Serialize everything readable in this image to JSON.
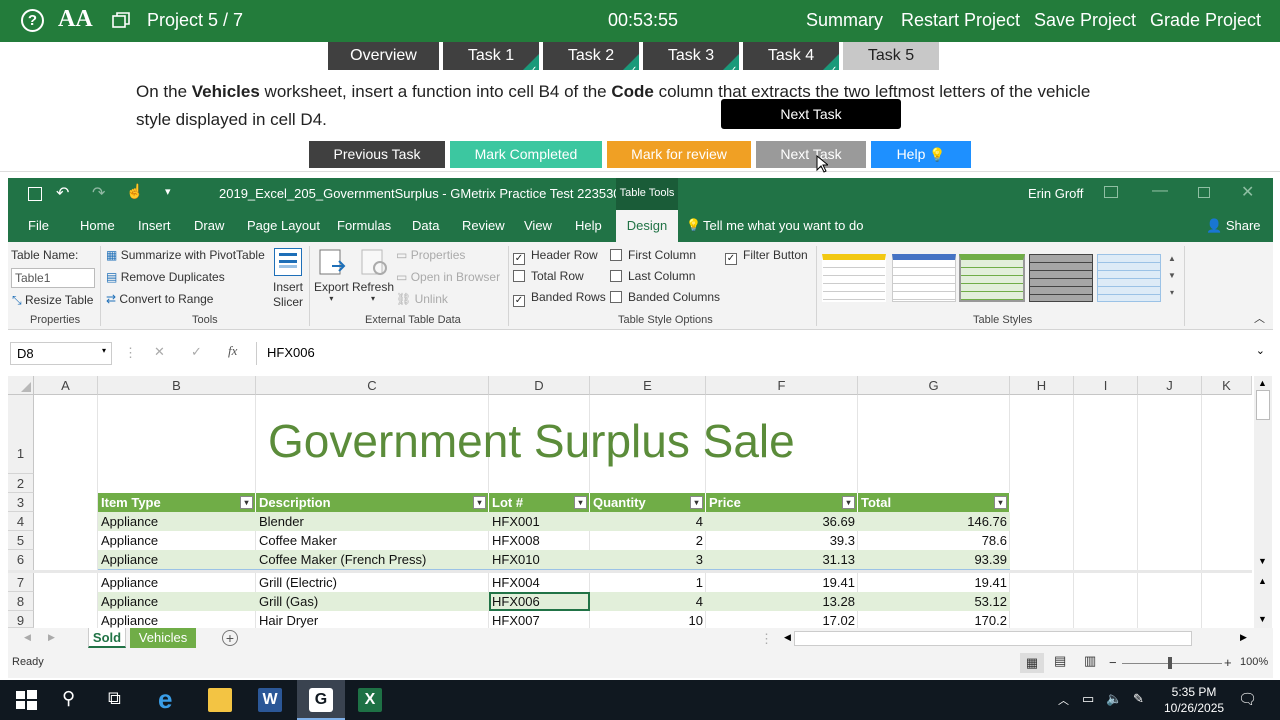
{
  "topbar": {
    "project": "Project 5 / 7",
    "timer": "00:53:55",
    "links": [
      "Summary",
      "Restart Project",
      "Save Project",
      "Grade Project"
    ],
    "font_icon": "AA"
  },
  "tasks": [
    {
      "label": "Overview",
      "done": false
    },
    {
      "label": "Task 1",
      "done": true
    },
    {
      "label": "Task 2",
      "done": true
    },
    {
      "label": "Task 3",
      "done": true
    },
    {
      "label": "Task 4",
      "done": true
    },
    {
      "label": "Task 5",
      "done": false,
      "active": true
    }
  ],
  "instruction": {
    "p1": "On the ",
    "b1": "Vehicles",
    "p2": " worksheet, insert a function into cell B4 of the ",
    "b2": "Code",
    "p3": " column that extracts the two leftmost letters of the vehicle style displayed in cell D4."
  },
  "tooltip": "Next Task",
  "actions": {
    "previous": "Previous Task",
    "mark_completed": "Mark Completed",
    "mark_review": "Mark for review",
    "next": "Next Task",
    "help": "Help"
  },
  "colors": {
    "brand": "#237c3b",
    "excel": "#217346",
    "table_header": "#70ad47",
    "title_green": "#5b8c3a",
    "review": "#f0a024",
    "completed": "#3cc7a0",
    "help": "#1e90ff"
  },
  "excel": {
    "filename": "2019_Excel_205_GovernmentSurplus  -  GMetrix Practice Test 223530",
    "context_tab": "Table Tools",
    "user": "Erin Groff",
    "menu": [
      "File",
      "Home",
      "Insert",
      "Draw",
      "Page Layout",
      "Formulas",
      "Data",
      "Review",
      "View",
      "Help",
      "Design"
    ],
    "tell_me": "Tell me what you want to do",
    "share": "Share",
    "ribbon": {
      "table_name_label": "Table Name:",
      "table_name_value": "Table1",
      "resize": "Resize Table",
      "properties": "Properties",
      "summarize": "Summarize with PivotTable",
      "remove_dup": "Remove Duplicates",
      "convert": "Convert to Range",
      "tools": "Tools",
      "insert_slicer_1": "Insert",
      "insert_slicer_2": "Slicer",
      "export": "Export",
      "refresh": "Refresh",
      "ext_properties": "Properties",
      "open_browser": "Open in Browser",
      "unlink": "Unlink",
      "external": "External Table Data",
      "header_row": "Header Row",
      "total_row": "Total Row",
      "banded_rows": "Banded Rows",
      "first_column": "First Column",
      "last_column": "Last Column",
      "banded_columns": "Banded Columns",
      "filter_button": "Filter Button",
      "style_options": "Table Style Options",
      "table_styles": "Table Styles"
    },
    "name_box": "D8",
    "formula": "HFX006",
    "columns": [
      "A",
      "B",
      "C",
      "D",
      "E",
      "F",
      "G",
      "H",
      "I",
      "J",
      "K"
    ],
    "sheet_title": "Government Surplus Sale",
    "headers": [
      "Item Type",
      "Description",
      "Lot #",
      "Quantity",
      "Price",
      "Total"
    ],
    "rows": [
      {
        "n": "4",
        "cells": [
          "Appliance",
          "Blender",
          "HFX001",
          "4",
          "36.69",
          "146.76"
        ]
      },
      {
        "n": "5",
        "cells": [
          "Appliance",
          "Coffee Maker",
          "HFX008",
          "2",
          "39.3",
          "78.6"
        ]
      },
      {
        "n": "6",
        "cells": [
          "Appliance",
          "Coffee Maker (French Press)",
          "HFX010",
          "3",
          "31.13",
          "93.39"
        ]
      },
      {
        "n": "7",
        "cells": [
          "Appliance",
          "Grill (Electric)",
          "HFX004",
          "1",
          "19.41",
          "19.41"
        ]
      },
      {
        "n": "8",
        "cells": [
          "Appliance",
          "Grill (Gas)",
          "HFX006",
          "4",
          "13.28",
          "53.12"
        ]
      },
      {
        "n": "9",
        "cells": [
          "Appliance",
          "Hair Dryer",
          "HFX007",
          "10",
          "17.02",
          "170.2"
        ]
      }
    ],
    "sheets": [
      "Sold",
      "Vehicles"
    ],
    "status": "Ready",
    "zoom": "100%"
  },
  "taskbar": {
    "time": "5:35 PM",
    "date": "10/26/2025"
  }
}
